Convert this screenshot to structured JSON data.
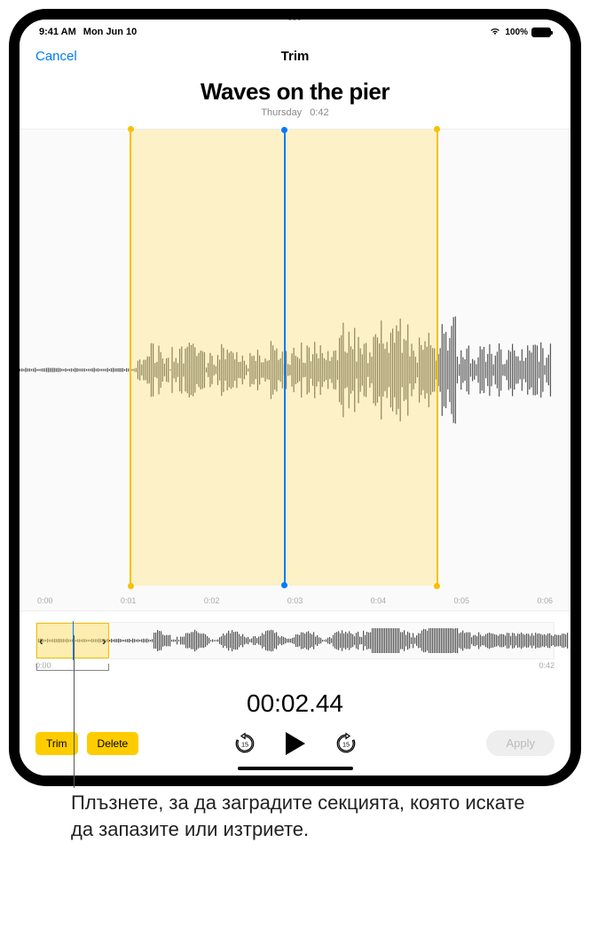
{
  "status": {
    "time": "9:41 AM",
    "date": "Mon Jun 10",
    "battery_pct": "100%"
  },
  "nav": {
    "cancel": "Cancel",
    "title": "Trim"
  },
  "recording": {
    "title": "Waves on the pier",
    "day": "Thursday",
    "duration": "0:42"
  },
  "ruler": {
    "labels": [
      "0:00",
      "0:01",
      "0:02",
      "0:03",
      "0:04",
      "0:05",
      "0:06"
    ]
  },
  "overview": {
    "start": "0:00",
    "end": "0:42"
  },
  "timecode": "00:02.44",
  "buttons": {
    "trim": "Trim",
    "delete": "Delete",
    "apply": "Apply",
    "skip_back": "15",
    "skip_fwd": "15"
  },
  "callout": "Плъзнете, за да заградите секцията, която искате да запазите или изтриете."
}
